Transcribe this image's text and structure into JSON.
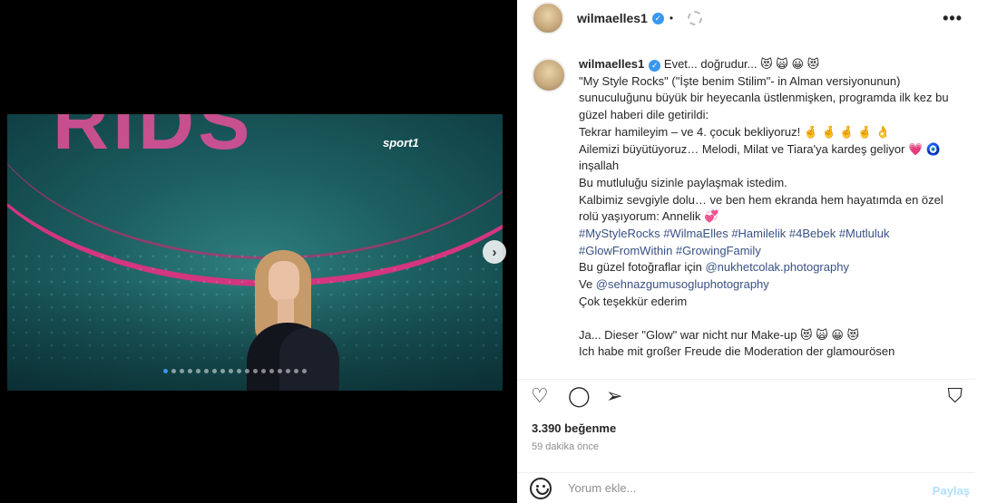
{
  "header": {
    "username": "wilmaelles1",
    "verified_glyph": "✓",
    "separator": "•",
    "more_glyph": "•••"
  },
  "media": {
    "watermark": "sport1",
    "next_glyph": "›",
    "carousel_count": 18,
    "carousel_active_index": 0
  },
  "caption": {
    "username": "wilmaelles1",
    "lines": [
      {
        "text": "Evet... doğrudur... 😻 🙀 😀 😻",
        "type": "first"
      },
      {
        "text": "\"My Style Rocks\" (\"İşte benim Stilim\"- in Alman versiyonunun) sunuculuğunu büyük bir heyecanla üstlenmişken, programda ilk kez bu güzel haberi dile getirildi:",
        "type": "text"
      },
      {
        "text": "Tekrar hamileyim – ve 4. çocuk bekliyoruz! 🤞 🤞 🤞 🤞 👌",
        "type": "text"
      },
      {
        "text": "Ailemizi büyütüyoruz… Melodi, Milat ve Tiara'ya kardeş geliyor 💗 🧿 inşallah",
        "type": "text"
      },
      {
        "text": "Bu mutluluğu sizinle paylaşmak istedim.",
        "type": "text"
      },
      {
        "text": "Kalbimiz sevgiyle dolu… ve ben hem ekranda hem hayatımda en özel rolü yaşıyorum: Annelik 💞",
        "type": "text"
      },
      {
        "text": "#MyStyleRocks #WilmaElles #Hamilelik #4Bebek #Mutluluk #GlowFromWithin #GrowingFamily",
        "type": "tag"
      },
      {
        "text": "Bu güzel fotoğraflar için ",
        "tag": "@nukhetcolak.photography",
        "type": "mixed"
      },
      {
        "text": "Ve ",
        "tag": "@sehnazgumusogluphotography",
        "type": "mixed"
      },
      {
        "text": "Çok teşekkür ederim",
        "type": "text"
      },
      {
        "text": "",
        "type": "gap"
      },
      {
        "text": "Ja... Dieser \"Glow\" war nicht nur Make-up 😻 🙀 😀 😻",
        "type": "text"
      },
      {
        "text": "Ich habe mit großer Freude die Moderation der glamourösen",
        "type": "text"
      }
    ]
  },
  "actions": {
    "like_glyph": "♡",
    "comment_glyph": "◯",
    "share_glyph": "➢",
    "save_glyph": "⛉"
  },
  "likes_text": "3.390 beğenme",
  "time_text": "59 dakika önce",
  "comment": {
    "placeholder": "Yorum ekle...",
    "post_label": "Paylaş"
  }
}
